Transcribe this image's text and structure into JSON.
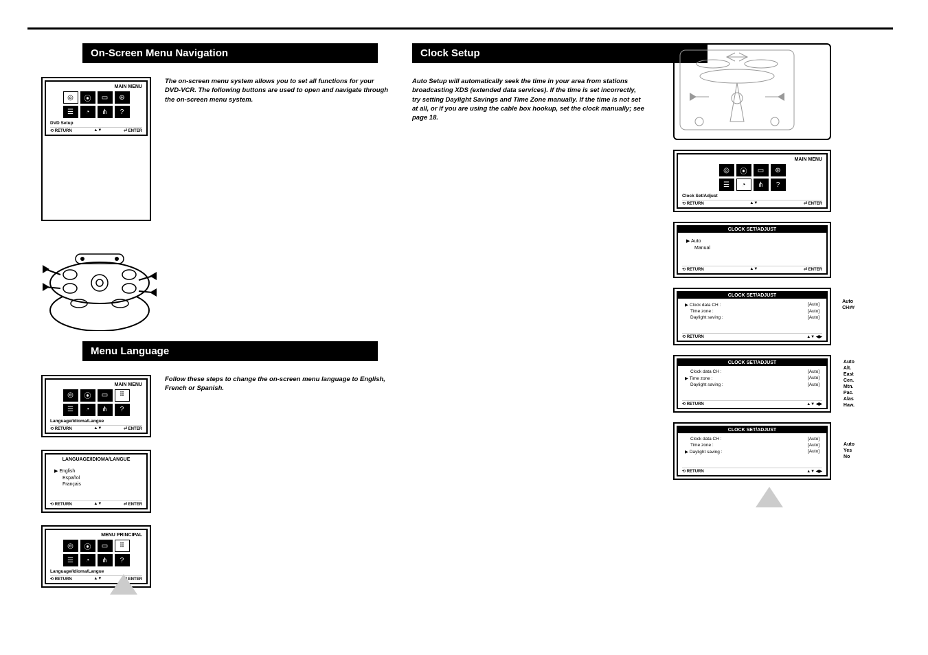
{
  "left": {
    "heading1": "On-Screen Menu Navigation",
    "intro1": "The on-screen menu system allows you to set all functions for your DVD-VCR. The following buttons are used to open and navigate through the on-screen menu system.",
    "heading2": "Menu Language",
    "intro2": "Follow these steps to change the on-screen menu language to English, French or Spanish.",
    "osd1": {
      "title": "MAIN MENU",
      "label": "DVD Setup",
      "return": "RETURN",
      "nav": "▲▼",
      "enter": "ENTER"
    },
    "osd2": {
      "title": "MAIN MENU",
      "label": "Language/Idioma/Langue",
      "return": "RETURN",
      "nav": "▲▼",
      "enter": "ENTER"
    },
    "osd3": {
      "title": "LANGUAGE/IDIOMA/LANGUE",
      "opt1": "English",
      "opt2": "Español",
      "opt3": "Français",
      "return": "RETURN",
      "nav": "▲▼",
      "enter": "ENTER"
    },
    "osd4": {
      "title": "MENU PRINCIPAL",
      "label": "Language/Idioma/Langue",
      "return": "RETURN",
      "nav": "▲▼",
      "enter": "ENTER"
    }
  },
  "right": {
    "heading": "Clock Setup",
    "intro": "Auto Setup will automatically seek the time in your area from stations broadcasting XDS (extended data services). If the time is set incorrectly, try setting Daylight Savings and Time Zone manually. If the time is not set at all, or if you are using the cable box hookup, set the clock manually; see page 18.",
    "r_osd1": {
      "title": "MAIN MENU",
      "label": "Clock Set/Adjust",
      "return": "RETURN",
      "nav": "▲▼",
      "enter": "ENTER"
    },
    "r_osd2": {
      "title": "CLOCK SET/ADJUST",
      "opt1": "Auto",
      "opt2": "Manual",
      "return": "RETURN",
      "nav": "▲▼",
      "enter": "ENTER"
    },
    "r_osd3": {
      "title": "CLOCK SET/ADJUST",
      "row1a": "Clock data CH :",
      "row1b": "[Auto]",
      "row2a": "Time zone :",
      "row2b": "[Auto]",
      "row3a": "Daylight saving :",
      "row3b": "[Auto]",
      "ann1": "Auto",
      "ann2": "CH##",
      "return": "RETURN",
      "nav": "▲▼  ◀▶"
    },
    "r_osd4": {
      "title": "CLOCK SET/ADJUST",
      "row1a": "Clock data CH :",
      "row1b": "[Auto]",
      "row2a": "Time zone :",
      "row2b": "[Auto]",
      "row3a": "Daylight saving :",
      "row3b": "[Auto]",
      "ann": [
        "Auto",
        "Alt.",
        "East",
        "Cen.",
        "Mtn.",
        "Pac.",
        "Alas",
        "Haw."
      ],
      "return": "RETURN",
      "nav": "▲▼  ◀▶"
    },
    "r_osd5": {
      "title": "CLOCK SET/ADJUST",
      "row1a": "Clock data CH :",
      "row1b": "[Auto]",
      "row2a": "Time zone :",
      "row2b": "[Auto]",
      "row3a": "Daylight saving :",
      "row3b": "[Auto]",
      "ann": [
        "Auto",
        "Yes",
        "No"
      ],
      "return": "RETURN",
      "nav": "▲▼  ◀▶"
    }
  },
  "icons": {
    "ret": "⟲",
    "play": "▶",
    "globe": "⊕",
    "list": "☰",
    "mic": "⍉",
    "ant": "⋔",
    "q": "?"
  }
}
